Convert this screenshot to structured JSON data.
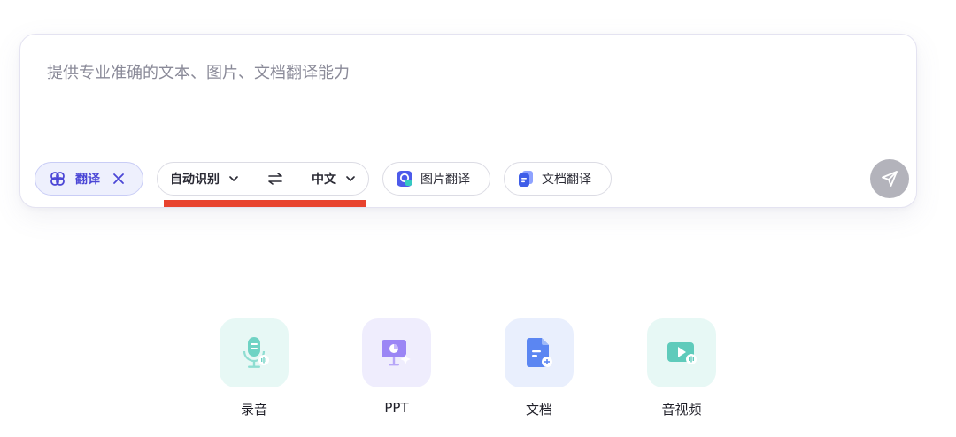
{
  "input": {
    "placeholder": "提供专业准确的文本、图片、文档翻译能力",
    "value": ""
  },
  "toolbar": {
    "mode_chip": {
      "label": "翻译",
      "icon": "translate-knot-icon",
      "close_icon": "close-icon"
    },
    "language": {
      "source": "自动识别",
      "target": "中文",
      "swap_icon": "swap-arrows-icon"
    },
    "features": [
      {
        "label": "图片翻译",
        "icon": "image-translate-icon"
      },
      {
        "label": "文档翻译",
        "icon": "document-translate-icon"
      }
    ],
    "send_icon": "send-icon"
  },
  "tools": [
    {
      "label": "录音",
      "icon": "microphone-icon",
      "bg": "#e7f8f5"
    },
    {
      "label": "PPT",
      "icon": "presentation-icon",
      "bg": "#efedfd"
    },
    {
      "label": "文档",
      "icon": "document-icon",
      "bg": "#e9effd"
    },
    {
      "label": "音视频",
      "icon": "video-icon",
      "bg": "#e7f8f5"
    }
  ],
  "colors": {
    "accent": "#4b46d6",
    "mode_chip_bg": "#eef0fd",
    "send_disabled": "#b3b3bb",
    "highlight_mark": "#e8432f"
  }
}
